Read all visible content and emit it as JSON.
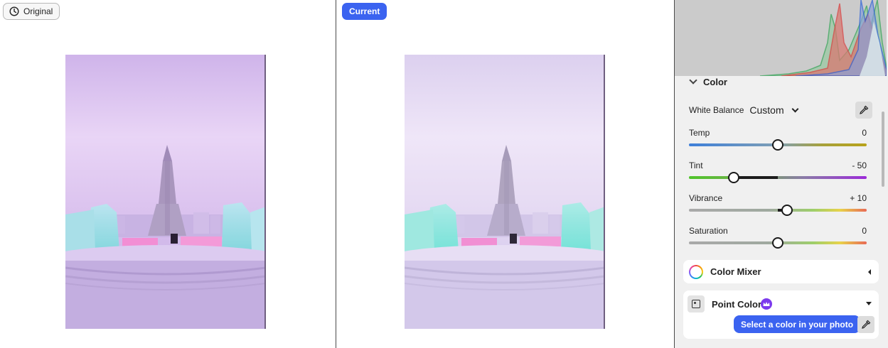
{
  "compare": {
    "original_label": "Original",
    "current_label": "Current",
    "original_photo_alt": "Ice castle photo before edits",
    "current_photo_alt": "Ice castle photo after edits"
  },
  "panel": {
    "histogram_icon": "histogram",
    "color_section": {
      "title": "Color",
      "expanded": true,
      "white_balance": {
        "label": "White Balance",
        "value": "Custom",
        "picker_icon": "eyedropper-icon"
      },
      "sliders": [
        {
          "label": "Temp",
          "value_text": "0",
          "value": 0,
          "min": -100,
          "max": 100,
          "track": "temp"
        },
        {
          "label": "Tint",
          "value_text": "- 50",
          "value": -50,
          "min": -100,
          "max": 100,
          "track": "tint"
        },
        {
          "label": "Vibrance",
          "value_text": "+ 10",
          "value": 10,
          "min": -100,
          "max": 100,
          "track": "vibrance"
        },
        {
          "label": "Saturation",
          "value_text": "0",
          "value": 0,
          "min": -100,
          "max": 100,
          "track": "saturation"
        }
      ]
    },
    "color_mixer": {
      "title": "Color Mixer",
      "icon": "color-wheel-icon",
      "expanded": false
    },
    "point_color": {
      "title": "Point Color",
      "icon": "point-color-icon",
      "badge_icon": "crown-icon",
      "expanded": true,
      "tooltip": "Select a color in your photo",
      "picker_icon": "eyedropper-icon"
    }
  },
  "colors": {
    "accent": "#3b63f0",
    "premium": "#7c3aed"
  }
}
